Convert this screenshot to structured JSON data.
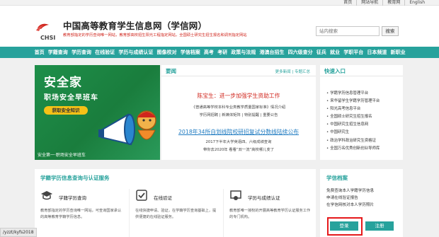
{
  "topbar": {
    "links": [
      "首页",
      "网站导航",
      "教育网",
      "English"
    ]
  },
  "header": {
    "logo_text": "CHSI",
    "title": "中国高等教育学生信息网（学信网）",
    "slogan": "教育部指定的学历查询唯一网站，教育部高校招生阳光工程指定网站，全国硕士研究生招生报名和调剂指定网站",
    "search_placeholder": "站内搜索",
    "search_label": "搜索"
  },
  "nav": {
    "items": [
      "首页",
      "学籍查询",
      "学历查询",
      "在线验证",
      "学历与成绩认证",
      "图像校对",
      "学信档案",
      "高考",
      "考研",
      "政策与法规",
      "港澳台招生",
      "四六级查分",
      "征兵",
      "就业",
      "学职平台",
      "日本频道",
      "新职业"
    ]
  },
  "banner": {
    "title": "安全家",
    "subtitle": "职场安全早班车",
    "button": "获取安全知识",
    "footer": "安全第一·职场安全早班车"
  },
  "news": {
    "title": "要闻",
    "more": "更多新闻",
    "topics": "专题汇总",
    "headline": "陈宝生：进一步加强学生资助工作",
    "line1": "《普通高等学校本科专业类教学质量国家标准》情况介绍",
    "line2": "学历网招聘 | 新媒体矩阵 | 特别提醒 | 重要公告",
    "headline2": "2018年34所自划线院校研招复试分数线陆续公布",
    "line3": "2017下半年大学英语四、六级成绩查询",
    "line4": "带你去2020年 看看“双一流”高校哪儿变了"
  },
  "quick": {
    "title": "快速入口",
    "items": [
      "学籍学历信息管理平台",
      "来华留学生学籍学历管理平台",
      "阳光高考信息平台",
      "全国硕士研究生招生报名",
      "中国研究生招生信息网",
      "中国研究生",
      "政治学科政治研究生资格证",
      "全国万名优秀创新创业导师库"
    ]
  },
  "services": {
    "title": "学籍学历信息查询与认证服务",
    "items": [
      {
        "name": "学籍学历查询",
        "desc": "教育部指定的学历查询唯一网站，可查询国家承认的高等教育学籍学历信息。"
      },
      {
        "name": "在线验证",
        "desc": "在线快捷申请、验证，在学籍学历查询基础上，提供便捷的在线验证服务。"
      },
      {
        "name": "学历与成绩认证",
        "desc": "教育部唯一授权的开展高等教育学历认证服务工作的专门机构。"
      }
    ]
  },
  "archive": {
    "title": "学信档案",
    "items": [
      "免费查询本人学籍学历信息",
      "申请在线验证报告",
      "在学信网核对本人学历照片"
    ],
    "login": "登录",
    "register": "注册"
  },
  "status_url": "/yzzt/kyfs2018"
}
